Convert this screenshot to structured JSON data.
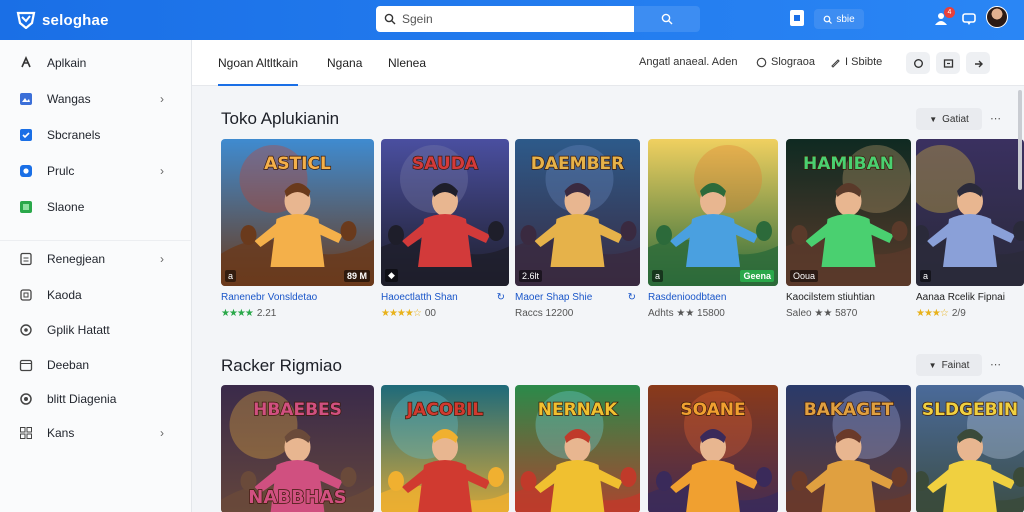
{
  "header": {
    "brand": "seloghae",
    "search_placeholder": "Sgein",
    "signin_label": "sbie",
    "notif_count": "4"
  },
  "sidebar": {
    "items": [
      {
        "label": "Aplkain",
        "icon": "apps-icon",
        "chevron": false
      },
      {
        "label": "Wangas",
        "icon": "image-icon",
        "chevron": true
      },
      {
        "label": "Sbcranels",
        "icon": "check-icon",
        "chevron": false
      },
      {
        "label": "Prulc",
        "icon": "record-icon",
        "chevron": true
      },
      {
        "label": "Slaone",
        "icon": "leaf-icon",
        "chevron": false
      },
      {
        "label": "Renegjean",
        "icon": "doc-icon",
        "chevron": true
      },
      {
        "label": "Kaoda",
        "icon": "box-icon",
        "chevron": false
      },
      {
        "label": "Gplik Hatatt",
        "icon": "gear-icon",
        "chevron": false
      },
      {
        "label": "Deeban",
        "icon": "calendar-icon",
        "chevron": false
      },
      {
        "label": "blitt Diagenia",
        "icon": "circle-icon",
        "chevron": false
      },
      {
        "label": "Kans",
        "icon": "grid-icon",
        "chevron": true
      }
    ]
  },
  "tabs": {
    "items": [
      "Ngoan Altltkain",
      "Ngana",
      "Nlenea"
    ],
    "right_links": [
      "Angatl anaeal. Aden",
      "Slograoa",
      "I Sbibte"
    ]
  },
  "sections": [
    {
      "title": "Toko Aplukianin",
      "button": "Gatiat",
      "cards": [
        {
          "name": "Ranenebr Vonsldetao",
          "extra": "",
          "rating_text": "2.21",
          "stars": "★★★★",
          "star_color": "green",
          "badge_tl": "a",
          "badge_br": "89 M",
          "br_style": ""
        },
        {
          "name": "Haoectlatth Shan",
          "extra": "↻",
          "rating_text": "00",
          "stars": "★★★★☆",
          "star_color": "gold",
          "badge_tl": "◆",
          "badge_br": "",
          "br_style": ""
        },
        {
          "name": "Maoer Shap Shie",
          "extra": "↻",
          "rating_text": "Raccs 12200",
          "stars": "",
          "star_color": "",
          "badge_tl": "2.6lt",
          "badge_br": "",
          "br_style": ""
        },
        {
          "name": "Rasdenioodbtaen",
          "extra": "",
          "rating_text": "Adhts ★★ 15800",
          "stars": "",
          "star_color": "",
          "badge_tl": "a",
          "badge_br": "Geena",
          "br_style": "green"
        },
        {
          "name": "Kaocilstem stiuhtian",
          "extra": "",
          "rating_text": "Saleo ★★ 5870",
          "stars": "",
          "star_color": "",
          "badge_tl": "Ooua",
          "badge_br": "",
          "br_style": ""
        },
        {
          "name": "Aanaa Rcelik Fipnai",
          "extra": "",
          "rating_text": "2/9",
          "stars": "★★★☆",
          "star_color": "gold",
          "badge_tl": "a",
          "badge_br": "",
          "br_style": ""
        }
      ]
    },
    {
      "title": "Racker Rigmiao",
      "button": "Fainat",
      "cards": [
        {
          "name": "",
          "thumb_text": "HBAEBES"
        },
        {
          "name": "",
          "thumb_text": "JACOBIL"
        },
        {
          "name": "",
          "thumb_text": "NERNAK"
        },
        {
          "name": "",
          "thumb_text": "SOANE"
        },
        {
          "name": "",
          "thumb_text": "BAKAGET"
        },
        {
          "name": "",
          "thumb_text": "SLDGEBIN"
        }
      ]
    }
  ],
  "thumb_titles_row1": [
    "ASTICL",
    "SAUDA",
    "DAEMBER",
    "",
    "HAMIBAN",
    ""
  ],
  "thumb_bottom_row2_first": "NABBHAS"
}
